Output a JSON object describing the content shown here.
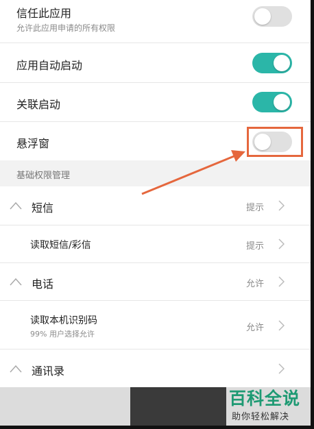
{
  "settings": {
    "trust_app": {
      "title": "信任此应用",
      "subtitle": "允许此应用申请的所有权限",
      "enabled": false
    },
    "auto_start": {
      "title": "应用自动启动",
      "enabled": true
    },
    "linked_start": {
      "title": "关联启动",
      "enabled": true
    },
    "floating_window": {
      "title": "悬浮窗",
      "enabled": false
    }
  },
  "permissions_header": "基础权限管理",
  "groups": {
    "sms": {
      "title": "短信",
      "value": "提示"
    },
    "read_sms": {
      "title": "读取短信/彩信",
      "value": "提示"
    },
    "phone": {
      "title": "电话",
      "value": "允许"
    },
    "read_device_id": {
      "title": "读取本机识别码",
      "subtitle": "99% 用户选择允许",
      "value": "允许"
    },
    "contacts": {
      "title": "通讯录"
    }
  },
  "watermark": {
    "brand": "百科全说",
    "slogan": "助你轻松解决"
  },
  "colors": {
    "toggle_on": "#2bb6a8",
    "toggle_off": "#e0e0e0",
    "annotation": "#e5673d",
    "watermark": "#1e9a73"
  }
}
